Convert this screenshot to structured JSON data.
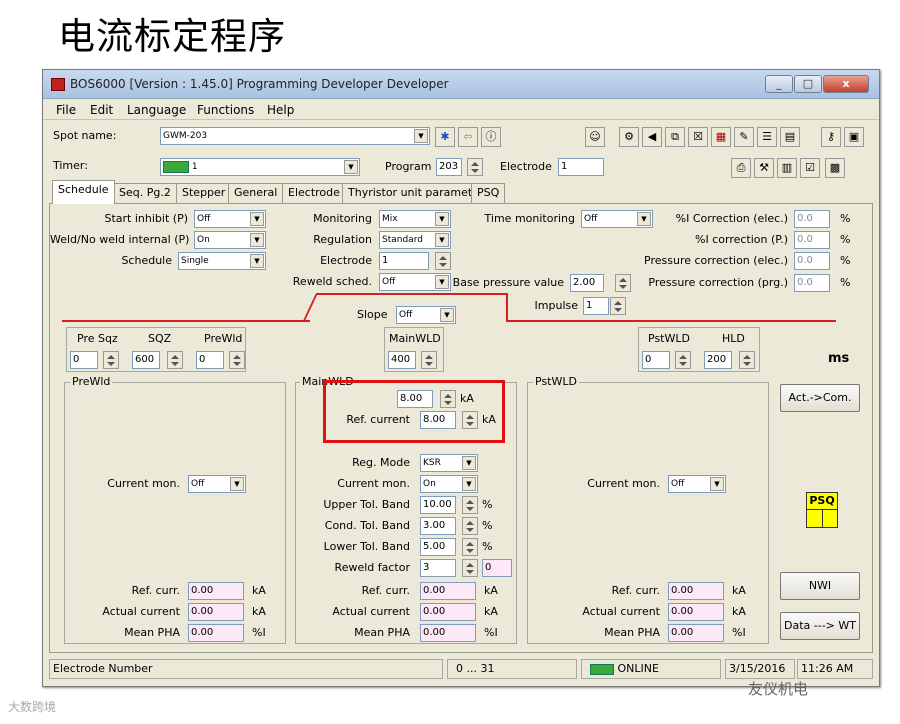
{
  "slide": {
    "title": "电流标定程序",
    "watermark_left": "大数跨境",
    "watermark_right": "友仪机电"
  },
  "window": {
    "title": "BOS6000 [Version : 1.45.0] Programming Developer Developer",
    "btn_min": "_",
    "btn_max": "□",
    "btn_close": "x"
  },
  "menu": [
    "File",
    "Edit",
    "Language",
    "Functions",
    "Help"
  ],
  "spot": {
    "label": "Spot name:",
    "value": "GWM-203"
  },
  "timer": {
    "label": "Timer:",
    "value": "1",
    "program_label": "Program",
    "program_value": "203",
    "electrode_label": "Electrode",
    "electrode_value": "1"
  },
  "tabs": [
    "Schedule",
    "Seq. Pg.2",
    "Stepper",
    "General",
    "Electrode",
    "Thyristor unit parameter",
    "PSQ"
  ],
  "params": {
    "start_inhibit": {
      "label": "Start inhibit (P)",
      "value": "Off"
    },
    "weld_internal": {
      "label": "Weld/No weld internal (P)",
      "value": "On"
    },
    "schedule": {
      "label": "Schedule",
      "value": "Single"
    },
    "monitoring": {
      "label": "Monitoring",
      "value": "Mix"
    },
    "regulation": {
      "label": "Regulation",
      "value": "Standard"
    },
    "electrode": {
      "label": "Electrode",
      "value": "1"
    },
    "reweld_sched": {
      "label": "Reweld sched.",
      "value": "Off"
    },
    "time_monitoring": {
      "label": "Time monitoring",
      "value": "Off"
    },
    "base_pressure": {
      "label": "Base pressure value",
      "value": "2.00"
    },
    "impulse": {
      "label": "Impulse",
      "value": "1"
    },
    "slope": {
      "label": "Slope",
      "value": "Off"
    },
    "corr_elec": {
      "label": "%I Correction (elec.)",
      "value": "0.0",
      "unit": "%"
    },
    "corr_p": {
      "label": "%I correction (P.)",
      "value": "0.0",
      "unit": "%"
    },
    "press_elec": {
      "label": "Pressure correction (elec.)",
      "value": "0.0",
      "unit": "%"
    },
    "press_prg": {
      "label": "Pressure correction (prg.)",
      "value": "0.0",
      "unit": "%"
    }
  },
  "times": {
    "pre_sqz": {
      "label": "Pre Sqz",
      "value": "0"
    },
    "sqz": {
      "label": "SQZ",
      "value": "600"
    },
    "prewld": {
      "label": "PreWld",
      "value": "0"
    },
    "mainwld": {
      "label": "MainWLD",
      "value": "400"
    },
    "pstwld": {
      "label": "PstWLD",
      "value": "0"
    },
    "hld": {
      "label": "HLD",
      "value": "200"
    },
    "unit": "ms"
  },
  "prewld_group": {
    "title": "PreWld",
    "current_mon_label": "Current mon.",
    "current_mon": "Off",
    "ref_curr_label": "Ref. curr.",
    "ref_curr": "0.00",
    "actual_label": "Actual current",
    "actual": "0.00",
    "pha_label": "Mean PHA",
    "pha": "0.00",
    "ka": "kA",
    "pct": "%I"
  },
  "main_group": {
    "title": "MainWLD",
    "current_value": "8.00",
    "current_unit": "kA",
    "ref_current_label": "Ref. current",
    "ref_current": "8.00",
    "reg_mode_label": "Reg. Mode",
    "reg_mode": "KSR",
    "current_mon_label": "Current mon.",
    "current_mon": "On",
    "upper_label": "Upper Tol. Band",
    "upper": "10.00",
    "cond_label": "Cond. Tol. Band",
    "cond": "3.00",
    "lower_label": "Lower Tol. Band",
    "lower": "5.00",
    "pct": "%",
    "reweld_label": "Reweld factor",
    "reweld": "3",
    "reweld2": "0",
    "ref_curr_label": "Ref. curr.",
    "ref_curr": "0.00",
    "actual_label": "Actual current",
    "actual": "0.00",
    "pha_label": "Mean PHA",
    "pha": "0.00",
    "ka": "kA",
    "pcti": "%I"
  },
  "pst_group": {
    "title": "PstWLD",
    "current_mon_label": "Current mon.",
    "current_mon": "Off",
    "ref_curr_label": "Ref. curr.",
    "ref_curr": "0.00",
    "actual_label": "Actual current",
    "actual": "0.00",
    "pha_label": "Mean PHA",
    "pha": "0.00",
    "ka": "kA",
    "pct": "%I"
  },
  "buttons": {
    "act_com": "Act.->Com.",
    "psq": "PSQ",
    "nwi": "NWI",
    "data_wt": "Data ---> WT"
  },
  "status": {
    "left": "Electrode Number",
    "range": "0 ... 31",
    "online": "ONLINE",
    "date": "3/15/2016",
    "time": "11:26 AM"
  },
  "colors": {
    "highlight_box": "#e01010",
    "red_line": "#d42020",
    "pink_field": "#fde8f7",
    "psq_yellow": "#ffff00"
  }
}
